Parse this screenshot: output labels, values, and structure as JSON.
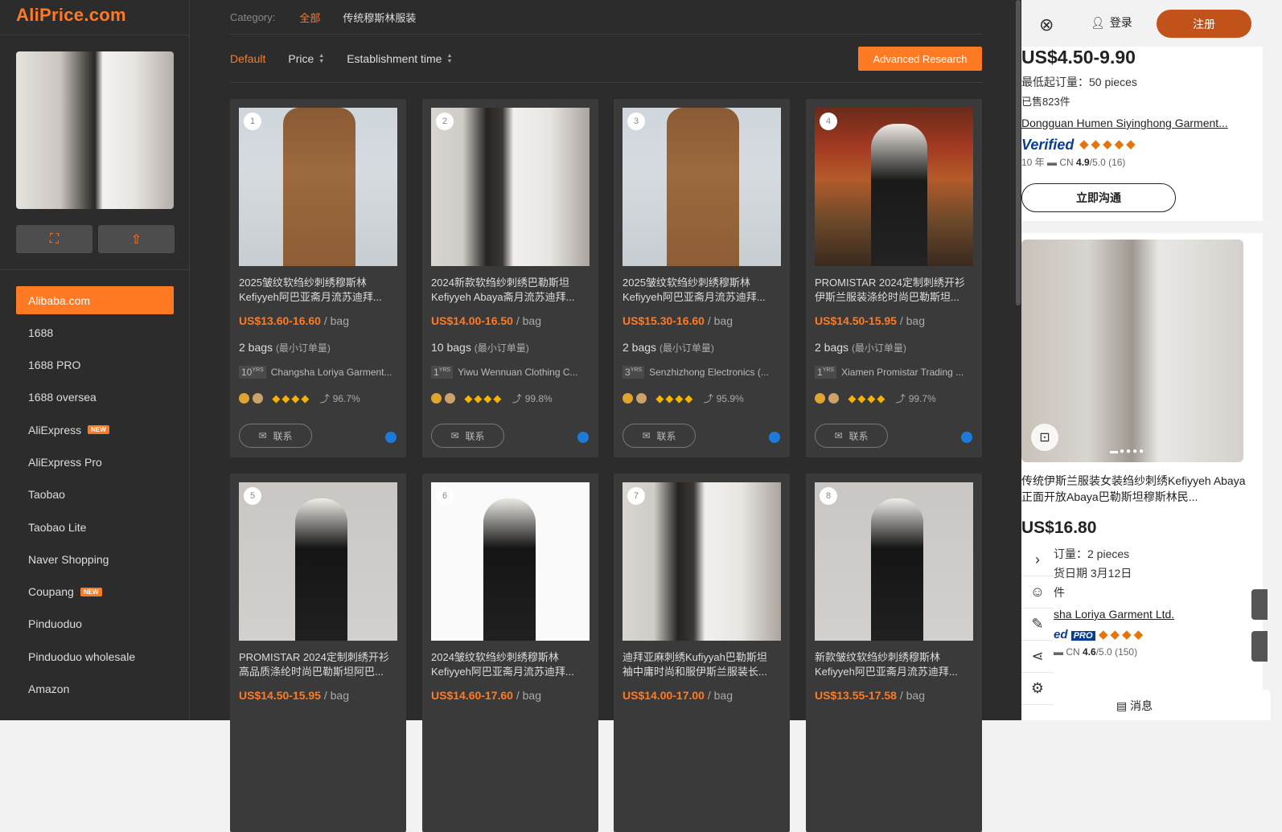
{
  "logo": "AliPrice.com",
  "category": {
    "label": "Category:",
    "all": "全部",
    "selected": "传统穆斯林服装"
  },
  "sort": {
    "default": "Default",
    "price": "Price",
    "established": "Establishment time",
    "advanced": "Advanced Research"
  },
  "platforms": [
    {
      "label": "Alibaba.com",
      "active": true,
      "badge": ""
    },
    {
      "label": "1688",
      "badge": ""
    },
    {
      "label": "1688 PRO",
      "badge": ""
    },
    {
      "label": "1688 oversea",
      "badge": ""
    },
    {
      "label": "AliExpress",
      "badge": "NEW"
    },
    {
      "label": "AliExpress Pro",
      "badge": ""
    },
    {
      "label": "Taobao",
      "badge": ""
    },
    {
      "label": "Taobao Lite",
      "badge": ""
    },
    {
      "label": "Naver Shopping",
      "badge": ""
    },
    {
      "label": "Coupang",
      "badge": "NEW"
    },
    {
      "label": "Pinduoduo",
      "badge": ""
    },
    {
      "label": "Pinduoduo wholesale",
      "badge": ""
    },
    {
      "label": "Amazon",
      "badge": ""
    }
  ],
  "products": [
    {
      "num": "1",
      "title1": "2025皱纹软绉纱刺绣穆斯林",
      "title2": "Kefiyyeh阿巴亚斋月流苏迪拜...",
      "price": "US$13.60-16.60",
      "unit": "/ bag",
      "moq": "2 bags",
      "moq_note": "(最小订单量)",
      "years": "10",
      "supplier": "Changsha Loriya Garment...",
      "rate": "96.7%",
      "contact": "联系",
      "photo": "p-brown"
    },
    {
      "num": "2",
      "title1": "2024新款软绉纱刺绣巴勒斯坦",
      "title2": "Kefiyyeh Abaya斋月流苏迪拜...",
      "price": "US$14.00-16.50",
      "unit": "/ bag",
      "moq": "10 bags",
      "moq_note": "(最小订单量)",
      "years": "1",
      "supplier": "Yiwu Wennuan Clothing C...",
      "rate": "99.8%",
      "contact": "联系",
      "photo": "p-duo"
    },
    {
      "num": "3",
      "title1": "2025皱纹软绉纱刺绣穆斯林",
      "title2": "Kefiyyeh阿巴亚斋月流苏迪拜...",
      "price": "US$15.30-16.60",
      "unit": "/ bag",
      "moq": "2 bags",
      "moq_note": "(最小订单量)",
      "years": "3",
      "supplier": "Senzhizhong Electronics (...",
      "rate": "95.9%",
      "contact": "联系",
      "photo": "p-brown"
    },
    {
      "num": "4",
      "title1": "PROMISTAR 2024定制刺绣开衫",
      "title2": "伊斯兰服装涤纶时尚巴勒斯坦...",
      "price": "US$14.50-15.95",
      "unit": "/ bag",
      "moq": "2 bags",
      "moq_note": "(最小订单量)",
      "years": "1",
      "supplier": "Xiamen Promistar Trading ...",
      "rate": "99.7%",
      "contact": "联系",
      "photo": "p-market"
    },
    {
      "num": "5",
      "title1": "PROMISTAR 2024定制刺绣开衫",
      "title2": "高品质涤纶时尚巴勒斯坦阿巴...",
      "price": "US$14.50-15.95",
      "unit": "/ bag",
      "photo": "p-single"
    },
    {
      "num": "6",
      "title1": "2024皱纹软绉纱刺绣穆斯林",
      "title2": "Kefiyyeh阿巴亚斋月流苏迪拜...",
      "price": "US$14.60-17.60",
      "unit": "/ bag",
      "photo": "p-white"
    },
    {
      "num": "7",
      "title1": "迪拜亚麻刺绣Kufiyyah巴勒斯坦",
      "title2": "袖中庸时尚和服伊斯兰服装长...",
      "price": "US$14.00-17.00",
      "unit": "/ bag",
      "photo": "p-duo"
    },
    {
      "num": "8",
      "title1": "新款皱纹软绉纱刺绣穆斯林",
      "title2": "Kefiyyeh阿巴亚斋月流苏迪拜...",
      "price": "US$13.55-17.58",
      "unit": "/ bag",
      "photo": "p-single"
    }
  ],
  "background": {
    "login": "登录",
    "register": "注册",
    "price1": "US$4.50-9.90",
    "moq1": "最低起订量：50 pieces",
    "sold1": "已售823件",
    "supplier1": "Dongguan Humen Siyinghong Garment...",
    "verified": "Verified",
    "stats1_years": "10 年",
    "stats1_country": "CN",
    "stats1_score": "4.9",
    "stats1_rest": "/5.0 (16)",
    "chat": "立即沟通",
    "title2": "传统伊斯兰服装女装绉纱刺绣Kefiyyeh Abaya正面开放Abaya巴勒斯坦穆斯林民...",
    "price2": "US$16.80",
    "moq2": "订量：2 pieces",
    "ship2": "货日期 3月12日",
    "item2": "件",
    "supplier2": "sha Loriya Garment Ltd.",
    "verified2": "ed",
    "pro": "PRO",
    "stats2_country": "CN",
    "stats2_score": "4.6",
    "stats2_rest": "/5.0 (150)",
    "message": "消息"
  }
}
